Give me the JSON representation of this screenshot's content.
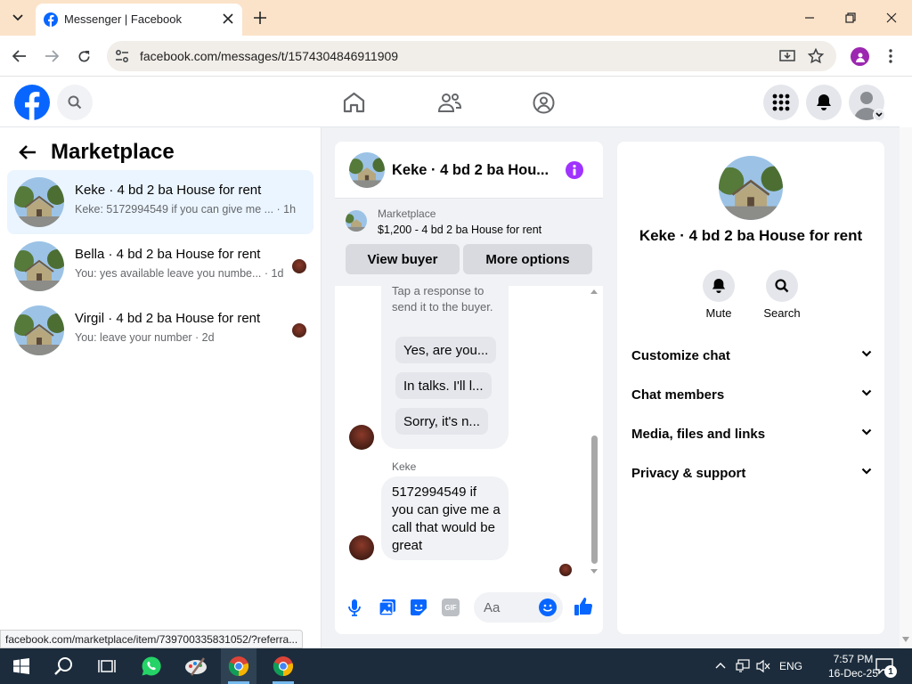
{
  "browser": {
    "tab_title": "Messenger | Facebook",
    "url": "facebook.com/messages/t/1574304846911909",
    "status_link": "facebook.com/marketplace/item/739700335831052/?referra..."
  },
  "left_panel": {
    "title": "Marketplace",
    "conversations": [
      {
        "name": "Keke · 4 bd 2 ba House for rent",
        "preview": "Keke: 5172994549 if you can give me ... · 1h",
        "active": true
      },
      {
        "name": "Bella · 4 bd 2 ba House for rent",
        "preview": "You: yes available leave you numbe... · 1d",
        "active": false
      },
      {
        "name": "Virgil · 4 bd 2 ba House for rent",
        "preview": "You: leave your number · 2d",
        "active": false
      }
    ]
  },
  "chat": {
    "title": "Keke · 4 bd 2 ba Hou...",
    "marketplace_label": "Marketplace",
    "listing": "$1,200 - 4 bd 2 ba House for rent",
    "view_buyer": "View buyer",
    "more_options": "More options",
    "tip_text": "Tap a response to send it to the buyer.",
    "quick_replies": [
      "Yes, are you...",
      "In talks. I'll l...",
      "Sorry, it's n..."
    ],
    "sender_name": "Keke",
    "message": "5172994549 if you can give me a call that would be great",
    "composer_placeholder": "Aa"
  },
  "info_panel": {
    "title": "Keke · 4 bd 2 ba House for rent",
    "mute_label": "Mute",
    "search_label": "Search",
    "sections": [
      "Customize chat",
      "Chat members",
      "Media, files and links",
      "Privacy & support"
    ]
  },
  "taskbar": {
    "language": "ENG",
    "time": "7:57 PM",
    "date": "16-Dec-25",
    "notification_count": "1"
  },
  "colors": {
    "facebook_blue": "#0866ff",
    "active_conversation": "#ebf5ff",
    "info_purple": "#a033ff",
    "taskbar": "#1c2c3c"
  }
}
